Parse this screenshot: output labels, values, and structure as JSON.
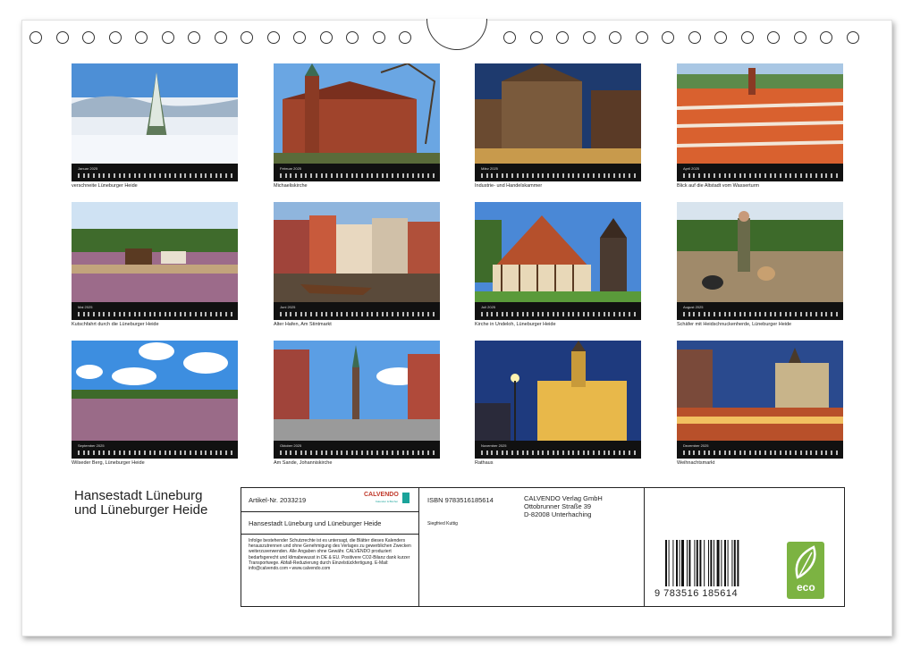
{
  "calendar_months": [
    {
      "month": "Januar 2025",
      "caption": "verschneite Lüneburger Heide"
    },
    {
      "month": "Februar 2025",
      "caption": "Michaeliskirche"
    },
    {
      "month": "März 2025",
      "caption": "Industrie- und Handelskammer"
    },
    {
      "month": "April 2025",
      "caption": "Blick auf die Altstadt vom Wasserturm"
    },
    {
      "month": "Mai 2025",
      "caption": "Kutschfahrt durch die Lüneburger Heide"
    },
    {
      "month": "Juni 2025",
      "caption": "Alter Hafen, Am Stintmarkt"
    },
    {
      "month": "Juli 2025",
      "caption": "Kirche in Undeloh, Lüneburger Heide"
    },
    {
      "month": "August 2025",
      "caption": "Schäfer mit Heidschnuckenherde, Lüneburger Heide"
    },
    {
      "month": "September 2025",
      "caption": "Wilseder Berg, Lüneburger Heide"
    },
    {
      "month": "Oktober 2025",
      "caption": "Am Sande, Johanniskirche"
    },
    {
      "month": "November 2025",
      "caption": "Rathaus"
    },
    {
      "month": "Dezember 2025",
      "caption": "Weihnachtsmarkt"
    }
  ],
  "title_line1": "Hansestadt Lüneburg",
  "title_line2": "und Lüneburger Heide",
  "article_number": "Artikel-Nr. 2033219",
  "brand": "CALVENDO",
  "brand_tagline": "Kalender & Bücher",
  "product_title": "Hansestadt Lüneburg und Lüneburger Heide",
  "legal_text": "Infolge bestehender Schutzrechte ist es untersagt, die Blätter dieses Kalenders herauszutrennen und ohne Genehmigung des Verlages zu gewerblichen Zwecken weiterzuverwenden. Alle Angaben ohne Gewähr. CALVENDO produziert bedarfsgerecht und klimabewusst in DE & EU. Positivere CO2-Bilanz dank kurzer Transportwege. Abfall-Reduzierung durch Einzelstückfertigung. E-Mail: info@calvendo.com • www.calvendo.com",
  "isbn": "ISBN 9783516185614",
  "publisher_name": "CALVENDO Verlag GmbH",
  "publisher_street": "Ottobrunner Straße 39",
  "publisher_city": "D-82008 Unterhaching",
  "author": "Siegfried Kuttig",
  "barcode_number": "9 783516 185614",
  "eco_label": "eco",
  "colors": {
    "eco_green": "#7cb342",
    "strip": "#111111",
    "brand_teal": "#1aa39a"
  }
}
